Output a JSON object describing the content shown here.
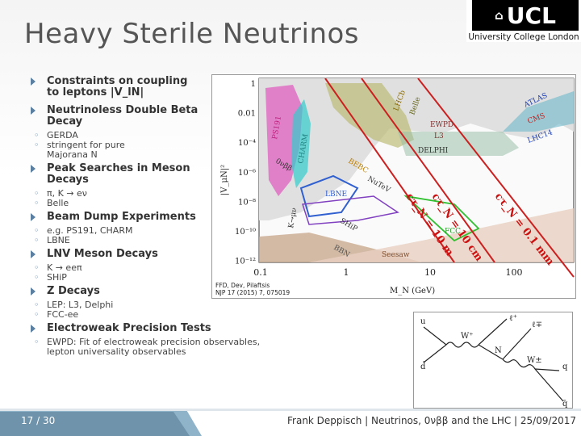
{
  "slide": {
    "title": "Heavy Sterile Neutrinos",
    "page": "17 / 30",
    "footer": "Frank Deppisch | Neutrinos, 0νββ and the LHC | 25/09/2017"
  },
  "logo": {
    "text": "UCL",
    "subtitle": "University College London"
  },
  "bullets": [
    {
      "label": "Constraints on coupling\nto leptons |V_lN|",
      "subs": []
    },
    {
      "label": "Neutrinoless Double Beta\nDecay",
      "subs": [
        "GERDA",
        "stringent for pure\nMajorana N"
      ]
    },
    {
      "label": "Peak Searches in Meson\nDecays",
      "subs": [
        "π, K → eν",
        "Belle"
      ]
    },
    {
      "label": "Beam Dump Experiments",
      "subs": [
        "e.g. PS191, CHARM",
        "LBNE"
      ]
    },
    {
      "label": "LNV Meson Decays",
      "subs": [
        "K → eeπ",
        "SHiP"
      ]
    },
    {
      "label": "Z Decays",
      "subs": [
        "LEP: L3, Delphi",
        "FCC-ee"
      ]
    },
    {
      "label": "Electroweak Precision Tests",
      "subs": [
        "EWPD: Fit of electroweak precision observables,\n        lepton universality observables"
      ]
    }
  ],
  "plot": {
    "credit": "FFD, Dev, Pilaftsis\nNJP 17 (2015) 7, 075019",
    "xlabel": "M_N (GeV)",
    "ylabel": "|V_μN|²",
    "xticks": [
      "0.1",
      "1",
      "10",
      "100"
    ],
    "yticks": [
      "1",
      "0.01",
      "10⁻⁴",
      "10⁻⁶",
      "10⁻⁸",
      "10⁻¹⁰",
      "10⁻¹²"
    ],
    "region_labels": [
      "PS191",
      "CHARM",
      "Belle",
      "LHCb",
      "EWPD",
      "L3",
      "DELPHI",
      "BEBC",
      "NuTeV",
      "LBNE",
      "SHiP",
      "BBN",
      "Seesaw",
      "FCC",
      "ATLAS",
      "CMS",
      "LHC14",
      "K→μν",
      "0νββ"
    ],
    "lifetime_labels": [
      "cτ_N = 10 m",
      "cτ_N = 10 cm",
      "cτ_N = 0.1 mm"
    ]
  },
  "feynman": {
    "labels": [
      "u",
      "d̄",
      "W⁺",
      "ℓ⁺",
      "N",
      "ℓ∓",
      "W±",
      "q",
      "q̄"
    ]
  }
}
